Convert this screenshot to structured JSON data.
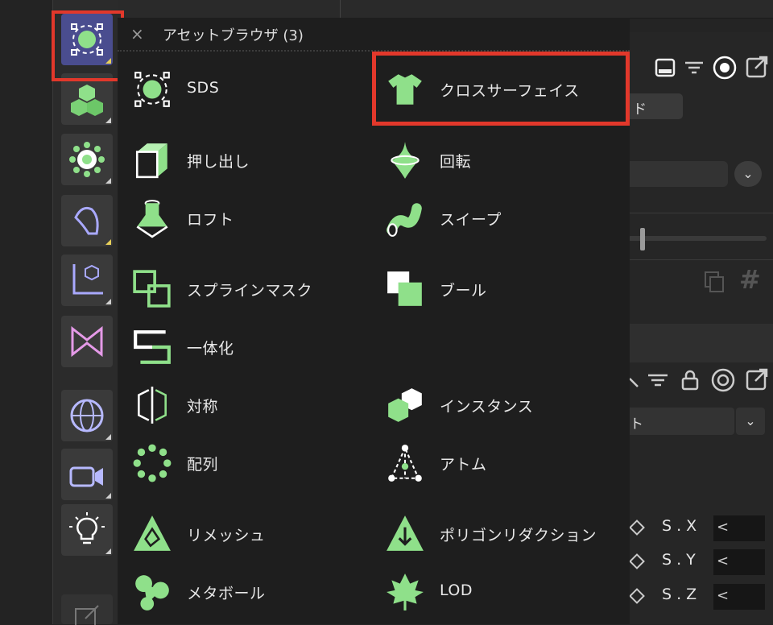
{
  "popup": {
    "close_glyph": "×",
    "title": "アセットブラウザ (3)",
    "items": [
      {
        "label": "SDS",
        "icon": "sds-icon"
      },
      {
        "label": "クロスサーフェイス",
        "icon": "shirt-icon"
      },
      {
        "label": "押し出し",
        "icon": "extrude-cube-icon"
      },
      {
        "label": "回転",
        "icon": "lathe-icon"
      },
      {
        "label": "ロフト",
        "icon": "loft-icon"
      },
      {
        "label": "スイープ",
        "icon": "sweep-tube-icon"
      },
      {
        "label": "スプラインマスク",
        "icon": "spline-mask-icon"
      },
      {
        "label": "ブール",
        "icon": "boole-icon"
      },
      {
        "label": "一体化",
        "icon": "connect-icon"
      },
      {
        "label": "対称",
        "icon": "symmetry-icon"
      },
      {
        "label": "インスタンス",
        "icon": "instance-icon"
      },
      {
        "label": "配列",
        "icon": "array-icon"
      },
      {
        "label": "アトム",
        "icon": "atom-icon"
      },
      {
        "label": "リメッシュ",
        "icon": "remesh-icon"
      },
      {
        "label": "ポリゴンリダクション",
        "icon": "polygon-reduction-icon"
      },
      {
        "label": "メタボール",
        "icon": "metaball-icon"
      },
      {
        "label": "LOD",
        "icon": "lod-leaf-icon"
      }
    ]
  },
  "right_panel": {
    "button_fragment": "ド",
    "field_fragment": "ト",
    "hash_glyph": "#",
    "coords": [
      {
        "label": "S . X",
        "arrow": "<"
      },
      {
        "label": "S . Y",
        "arrow": "<"
      },
      {
        "label": "S . Z",
        "arrow": "<"
      }
    ]
  },
  "colors": {
    "accent_green": "#8fe08a",
    "highlight_red": "#e2382b",
    "active_tool": "#4a4d8f"
  }
}
